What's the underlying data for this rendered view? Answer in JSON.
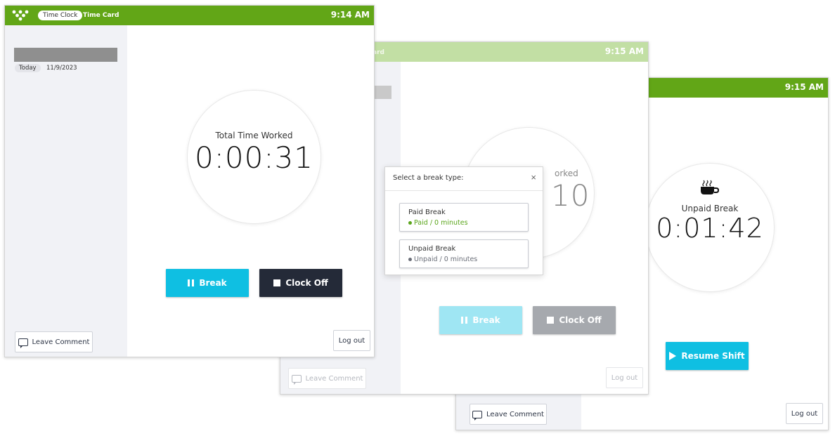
{
  "colors": {
    "brand_green": "#62a617",
    "brand_green_faded": "#c2dfa4",
    "break_blue": "#0fbfe2",
    "clock_dark": "#242a38",
    "paid_green": "#5aa51b",
    "unpaid_gray": "#6a6e78"
  },
  "screen1": {
    "topbar": {
      "tab_active": "Time Clock",
      "tab_other": "Time Card",
      "time": "9:14 AM"
    },
    "sidebar": {
      "date_badge": "Today",
      "date": "11/9/2023"
    },
    "circle": {
      "label": "Total Time Worked",
      "timer": "0:00:31"
    },
    "buttons": {
      "break": "Break",
      "clock_off": "Clock Off",
      "leave_comment": "Leave Comment",
      "logout": "Log out"
    }
  },
  "screen2": {
    "topbar": {
      "tab_other_partial": "ard",
      "time": "9:15 AM"
    },
    "circle": {
      "label_partial": "orked",
      "timer_partial": "10"
    },
    "dialog": {
      "title": "Select a break type:",
      "close": "×",
      "options": [
        {
          "name": "Paid Break",
          "sub": "Paid / 0 minutes"
        },
        {
          "name": "Unpaid Break",
          "sub": "Unpaid / 0 minutes"
        }
      ]
    },
    "buttons": {
      "break": "Break",
      "clock_off": "Clock Off",
      "leave_comment": "Leave Comment",
      "logout": "Log out"
    }
  },
  "screen3": {
    "topbar": {
      "time": "9:15 AM"
    },
    "circle": {
      "icon": "coffee-cup-icon",
      "label": "Unpaid Break",
      "timer": "0:01:42"
    },
    "buttons": {
      "resume": "Resume Shift",
      "leave_comment": "Leave Comment",
      "logout": "Log out"
    }
  }
}
